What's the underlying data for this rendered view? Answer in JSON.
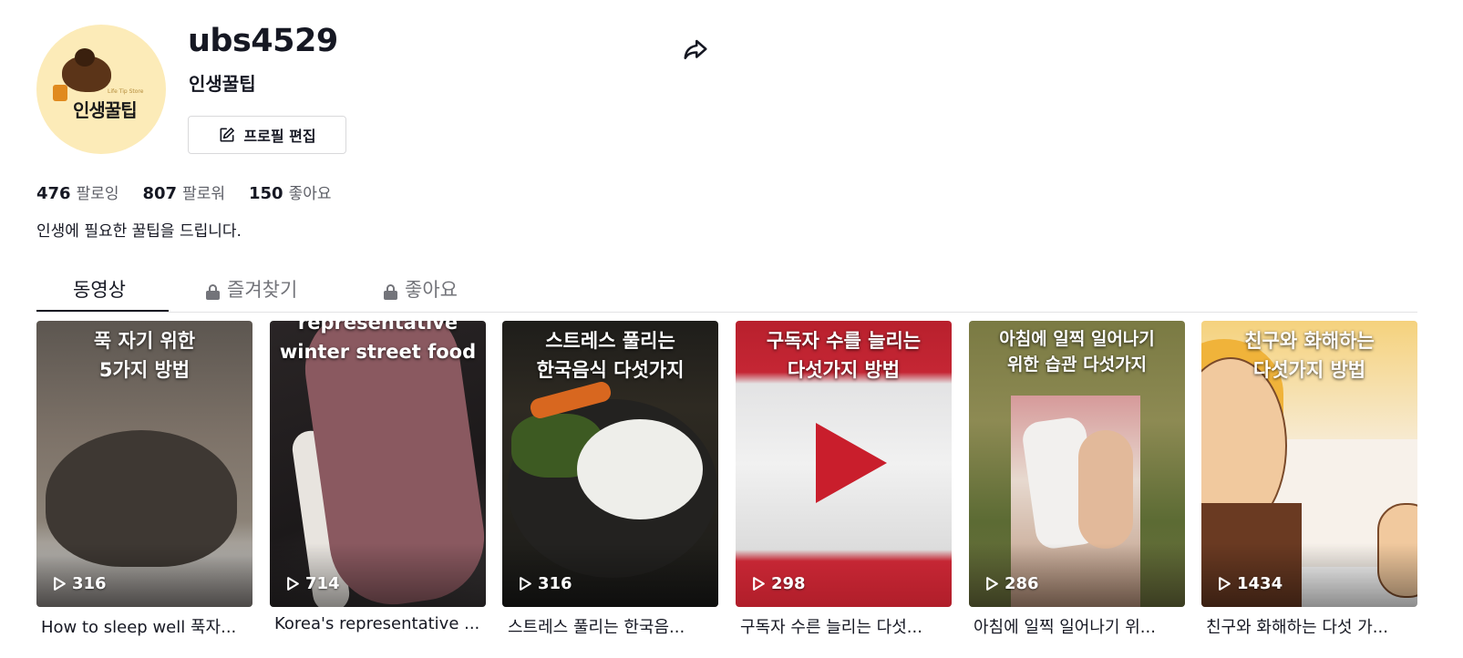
{
  "profile": {
    "username": "ubs4529",
    "nickname": "인생꿀팁",
    "avatar_text": "인생꿀팁",
    "avatar_subtext": "Life Tip Store",
    "edit_button": "프로필 편집",
    "bio": "인생에 필요한 꿀팁을 드립니다."
  },
  "stats": [
    {
      "value": "476",
      "label": "팔로잉"
    },
    {
      "value": "807",
      "label": "팔로워"
    },
    {
      "value": "150",
      "label": "좋아요"
    }
  ],
  "tabs": [
    {
      "label": "동영상",
      "active": true,
      "locked": false
    },
    {
      "label": "즐겨찾기",
      "active": false,
      "locked": true
    },
    {
      "label": "좋아요",
      "active": false,
      "locked": true
    }
  ],
  "videos": [
    {
      "overlay": "푹 자기 위한\n5가지 방법",
      "plays": "316",
      "title": "How to sleep well 푹자..."
    },
    {
      "overlay": "representative\nwinter street food",
      "plays": "714",
      "title": "Korea's representative ..."
    },
    {
      "overlay": "스트레스 풀리는\n한국음식 다섯가지",
      "plays": "316",
      "title": "스트레스 풀리는 한국음..."
    },
    {
      "overlay": "구독자 수를 늘리는\n다섯가지 방법",
      "plays": "298",
      "title": "구독자 수른 늘리는 다섯..."
    },
    {
      "overlay": "아침에 일찍 일어나기\n위한 습관 다섯가지",
      "plays": "286",
      "title": "아침에 일찍 일어나기 위..."
    },
    {
      "overlay": "친구와 화해하는\n다섯가지 방법",
      "plays": "1434",
      "title": "친구와 화해하는 다섯 가..."
    }
  ],
  "icons": {
    "share": "share-icon",
    "edit": "edit-icon",
    "lock": "lock-icon",
    "play": "play-icon"
  }
}
